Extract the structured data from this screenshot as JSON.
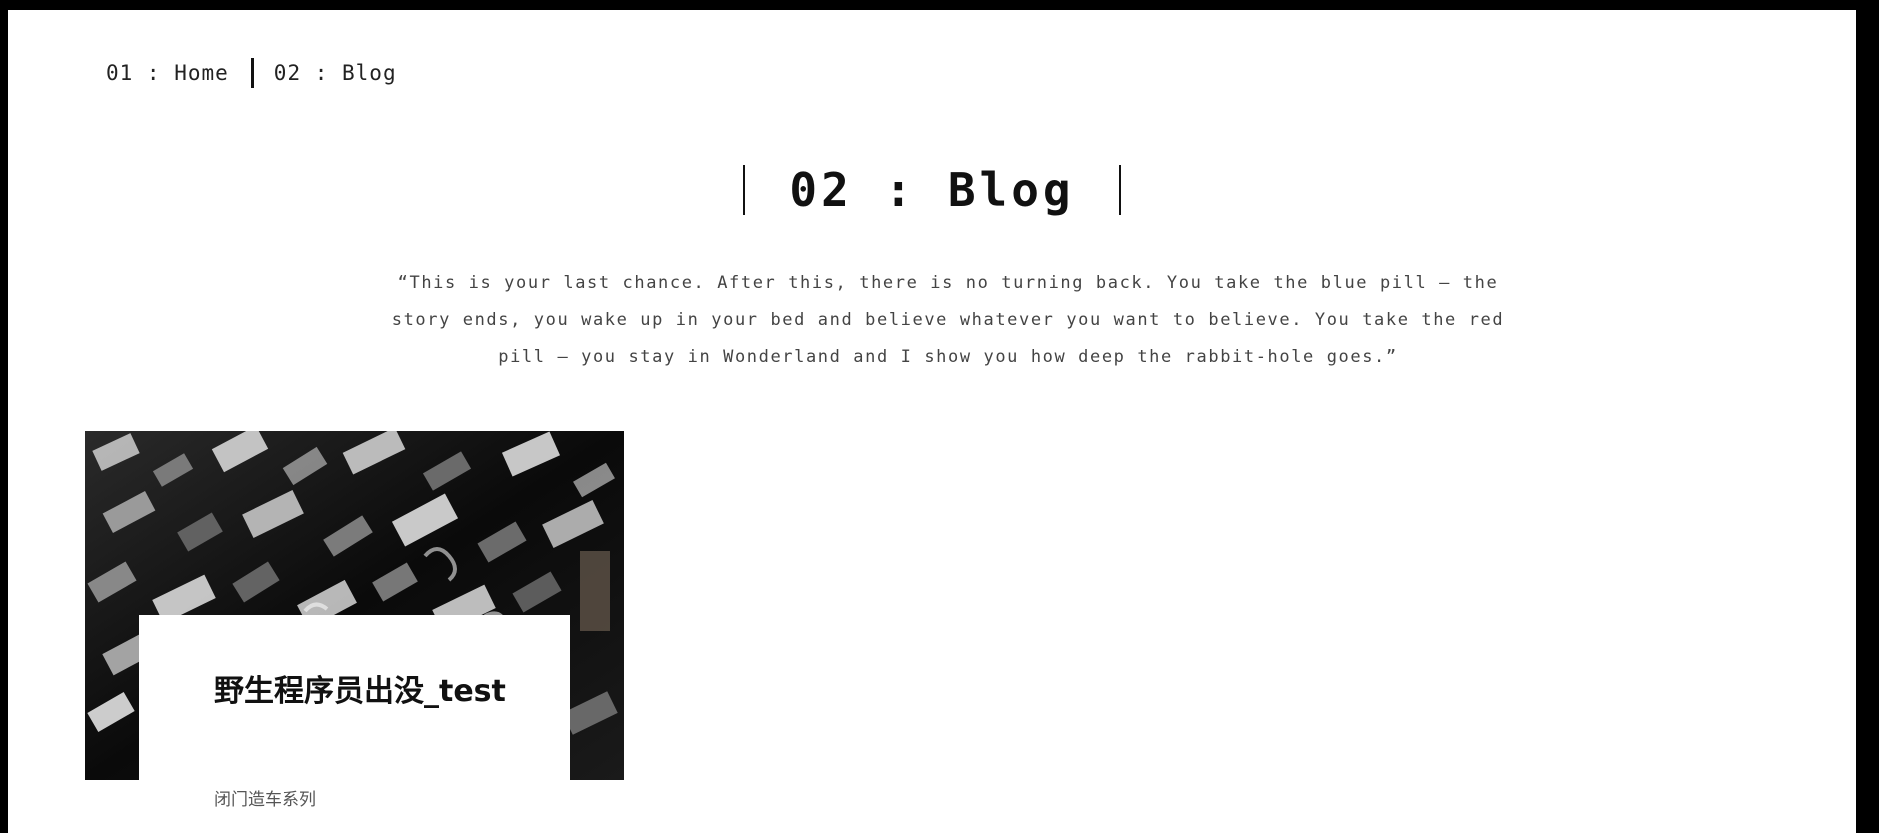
{
  "nav": {
    "items": [
      {
        "label": "01 : Home"
      },
      {
        "label": "02 : Blog"
      }
    ]
  },
  "header": {
    "title": "02 : Blog",
    "quote": "“This is your last chance. After this, there is no turning back. You take the blue pill – the story ends, you wake up in your bed and believe whatever you want to believe. You take the red pill – you stay in Wonderland and I show you how deep the rabbit-hole goes.”"
  },
  "posts": [
    {
      "title": "野生程序员出没_test",
      "subtitle": "闭门造车系列",
      "image_icon": "letterpress-type-image"
    }
  ],
  "colors": {
    "frame": "#000000",
    "background": "#ffffff",
    "text": "#111111",
    "muted": "#555555"
  }
}
